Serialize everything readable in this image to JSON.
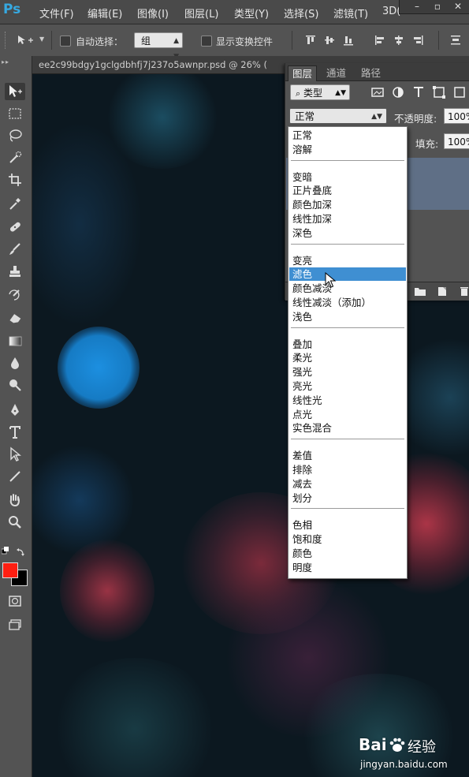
{
  "app": {
    "logo": "Ps"
  },
  "menu": {
    "items": [
      "文件(F)",
      "编辑(E)",
      "图像(I)",
      "图层(L)",
      "类型(Y)",
      "选择(S)",
      "滤镜(T)",
      "3D("
    ]
  },
  "options_bar": {
    "auto_select_label": "自动选择：",
    "auto_select_value": "组",
    "show_transform_label": "显示变换控件"
  },
  "document": {
    "tab_title": "ee2c99bdgy1gclgdbhfj7j237o5awnpr.psd @ 26% ("
  },
  "layers_panel": {
    "tabs": [
      "图层",
      "通道",
      "路径"
    ],
    "active_tab": 0,
    "filter_kind": "类型",
    "blend_mode": "正常",
    "opacity_label": "不透明度:",
    "opacity_value": "100%",
    "fill_label": "填充:",
    "fill_value": "100%"
  },
  "blend_menu": {
    "groups": [
      [
        "正常",
        "溶解"
      ],
      [
        "变暗",
        "正片叠底",
        "颜色加深",
        "线性加深",
        "深色"
      ],
      [
        "变亮",
        "滤色",
        "颜色减淡",
        "线性减淡（添加）",
        "浅色"
      ],
      [
        "叠加",
        "柔光",
        "强光",
        "亮光",
        "线性光",
        "点光",
        "实色混合"
      ],
      [
        "差值",
        "排除",
        "减去",
        "划分"
      ],
      [
        "色相",
        "饱和度",
        "颜色",
        "明度"
      ]
    ],
    "highlighted": "滤色"
  },
  "colors": {
    "foreground": "#ff1f12",
    "background": "#000000",
    "highlight": "#3f8fd2",
    "ps_blue": "#36a9e1"
  },
  "watermark": {
    "brand": "Bai",
    "brand_suffix": "经验",
    "url": "jingyan.baidu.com"
  }
}
